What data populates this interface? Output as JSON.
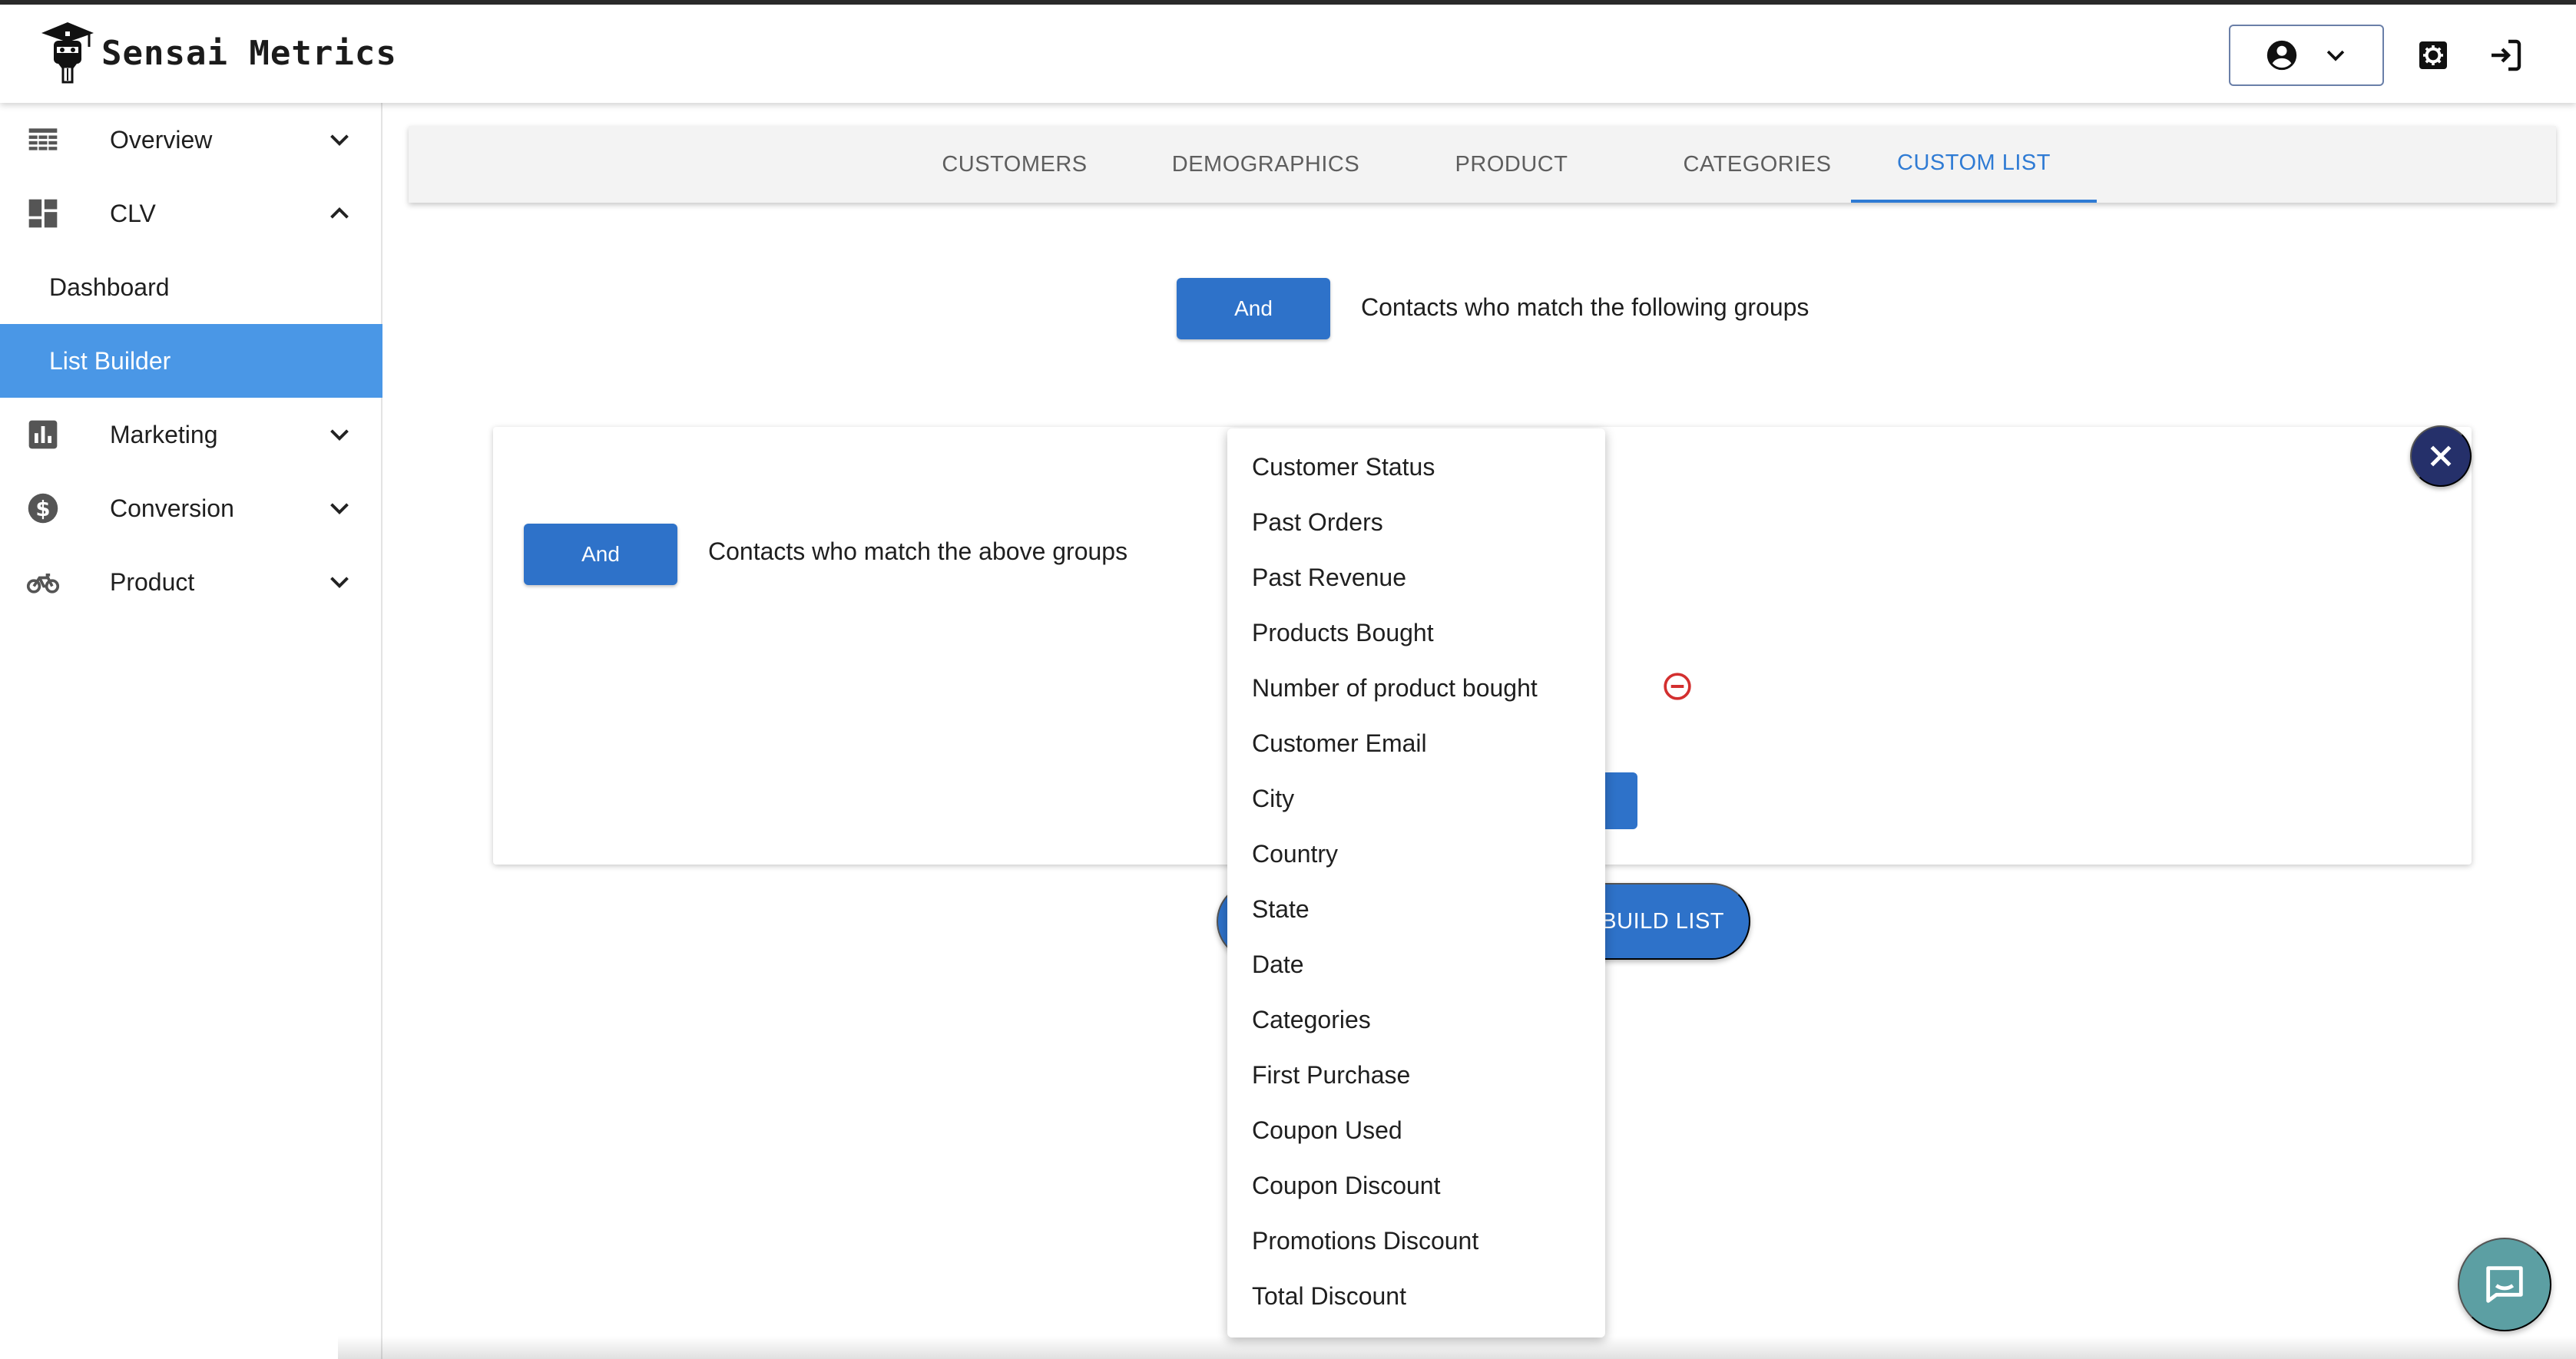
{
  "brand": {
    "name": "Sensai Metrics"
  },
  "header": {
    "account_icon": "account-circle-icon",
    "settings_icon": "settings-icon",
    "logout_icon": "logout-icon"
  },
  "sidebar": {
    "items": [
      {
        "label": "Overview",
        "icon": "table-icon",
        "expanded": false
      },
      {
        "label": "CLV",
        "icon": "dashboard-icon",
        "expanded": true,
        "children": [
          {
            "label": "Dashboard"
          },
          {
            "label": "List Builder",
            "active": true
          }
        ]
      },
      {
        "label": "Marketing",
        "icon": "bar-chart-icon",
        "expanded": false
      },
      {
        "label": "Conversion",
        "icon": "dollar-icon",
        "expanded": false
      },
      {
        "label": "Product",
        "icon": "bike-icon",
        "expanded": false
      }
    ]
  },
  "tabs": [
    {
      "label": "CUSTOMERS"
    },
    {
      "label": "DEMOGRAPHICS"
    },
    {
      "label": "PRODUCT"
    },
    {
      "label": "CATEGORIES"
    },
    {
      "label": "CUSTOM LIST",
      "active": true
    }
  ],
  "main": {
    "top_group": {
      "operator": "And",
      "text": "Contacts who match the following groups"
    },
    "inner_group": {
      "operator": "And",
      "text": "Contacts who match the above groups"
    },
    "build_button": "BUILD LIST"
  },
  "dropdown": {
    "options": [
      "Customer Status",
      "Past Orders",
      "Past Revenue",
      "Products Bought",
      "Number of product bought",
      "Customer Email",
      "City",
      "Country",
      "State",
      "Date",
      "Categories",
      "First Purchase",
      "Coupon Used",
      "Coupon Discount",
      "Promotions Discount",
      "Total Discount"
    ]
  },
  "colors": {
    "primary": "#2e72c9",
    "active_nav": "#4a97e6",
    "fab_dark": "#25306a",
    "chat": "#5c9fa3",
    "danger": "#d32f2f"
  }
}
